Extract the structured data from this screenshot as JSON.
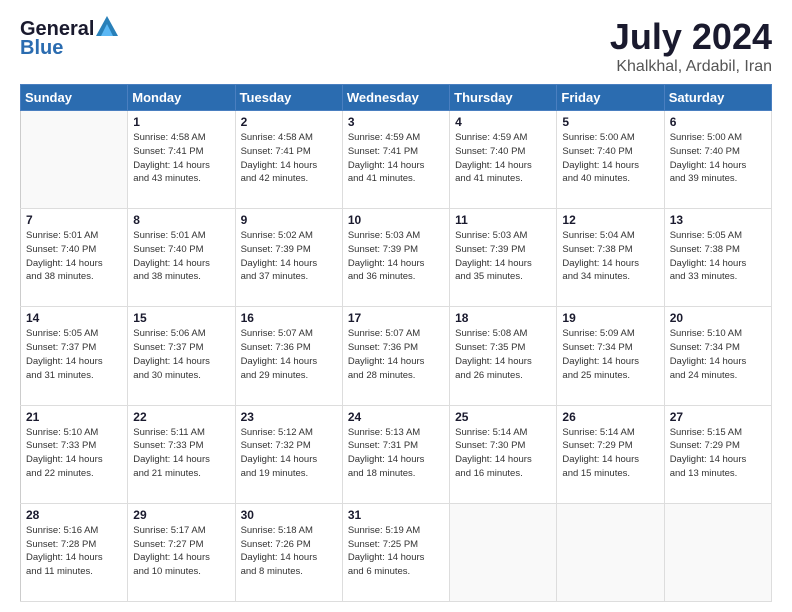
{
  "logo": {
    "line1": "General",
    "line2": "Blue"
  },
  "title": "July 2024",
  "subtitle": "Khalkhal, Ardabil, Iran",
  "weekdays": [
    "Sunday",
    "Monday",
    "Tuesday",
    "Wednesday",
    "Thursday",
    "Friday",
    "Saturday"
  ],
  "weeks": [
    [
      {
        "day": null,
        "sunrise": null,
        "sunset": null,
        "daylight": null
      },
      {
        "day": "1",
        "sunrise": "4:58 AM",
        "sunset": "7:41 PM",
        "daylight": "14 hours and 43 minutes."
      },
      {
        "day": "2",
        "sunrise": "4:58 AM",
        "sunset": "7:41 PM",
        "daylight": "14 hours and 42 minutes."
      },
      {
        "day": "3",
        "sunrise": "4:59 AM",
        "sunset": "7:41 PM",
        "daylight": "14 hours and 41 minutes."
      },
      {
        "day": "4",
        "sunrise": "4:59 AM",
        "sunset": "7:40 PM",
        "daylight": "14 hours and 41 minutes."
      },
      {
        "day": "5",
        "sunrise": "5:00 AM",
        "sunset": "7:40 PM",
        "daylight": "14 hours and 40 minutes."
      },
      {
        "day": "6",
        "sunrise": "5:00 AM",
        "sunset": "7:40 PM",
        "daylight": "14 hours and 39 minutes."
      }
    ],
    [
      {
        "day": "7",
        "sunrise": "5:01 AM",
        "sunset": "7:40 PM",
        "daylight": "14 hours and 38 minutes."
      },
      {
        "day": "8",
        "sunrise": "5:01 AM",
        "sunset": "7:40 PM",
        "daylight": "14 hours and 38 minutes."
      },
      {
        "day": "9",
        "sunrise": "5:02 AM",
        "sunset": "7:39 PM",
        "daylight": "14 hours and 37 minutes."
      },
      {
        "day": "10",
        "sunrise": "5:03 AM",
        "sunset": "7:39 PM",
        "daylight": "14 hours and 36 minutes."
      },
      {
        "day": "11",
        "sunrise": "5:03 AM",
        "sunset": "7:39 PM",
        "daylight": "14 hours and 35 minutes."
      },
      {
        "day": "12",
        "sunrise": "5:04 AM",
        "sunset": "7:38 PM",
        "daylight": "14 hours and 34 minutes."
      },
      {
        "day": "13",
        "sunrise": "5:05 AM",
        "sunset": "7:38 PM",
        "daylight": "14 hours and 33 minutes."
      }
    ],
    [
      {
        "day": "14",
        "sunrise": "5:05 AM",
        "sunset": "7:37 PM",
        "daylight": "14 hours and 31 minutes."
      },
      {
        "day": "15",
        "sunrise": "5:06 AM",
        "sunset": "7:37 PM",
        "daylight": "14 hours and 30 minutes."
      },
      {
        "day": "16",
        "sunrise": "5:07 AM",
        "sunset": "7:36 PM",
        "daylight": "14 hours and 29 minutes."
      },
      {
        "day": "17",
        "sunrise": "5:07 AM",
        "sunset": "7:36 PM",
        "daylight": "14 hours and 28 minutes."
      },
      {
        "day": "18",
        "sunrise": "5:08 AM",
        "sunset": "7:35 PM",
        "daylight": "14 hours and 26 minutes."
      },
      {
        "day": "19",
        "sunrise": "5:09 AM",
        "sunset": "7:34 PM",
        "daylight": "14 hours and 25 minutes."
      },
      {
        "day": "20",
        "sunrise": "5:10 AM",
        "sunset": "7:34 PM",
        "daylight": "14 hours and 24 minutes."
      }
    ],
    [
      {
        "day": "21",
        "sunrise": "5:10 AM",
        "sunset": "7:33 PM",
        "daylight": "14 hours and 22 minutes."
      },
      {
        "day": "22",
        "sunrise": "5:11 AM",
        "sunset": "7:33 PM",
        "daylight": "14 hours and 21 minutes."
      },
      {
        "day": "23",
        "sunrise": "5:12 AM",
        "sunset": "7:32 PM",
        "daylight": "14 hours and 19 minutes."
      },
      {
        "day": "24",
        "sunrise": "5:13 AM",
        "sunset": "7:31 PM",
        "daylight": "14 hours and 18 minutes."
      },
      {
        "day": "25",
        "sunrise": "5:14 AM",
        "sunset": "7:30 PM",
        "daylight": "14 hours and 16 minutes."
      },
      {
        "day": "26",
        "sunrise": "5:14 AM",
        "sunset": "7:29 PM",
        "daylight": "14 hours and 15 minutes."
      },
      {
        "day": "27",
        "sunrise": "5:15 AM",
        "sunset": "7:29 PM",
        "daylight": "14 hours and 13 minutes."
      }
    ],
    [
      {
        "day": "28",
        "sunrise": "5:16 AM",
        "sunset": "7:28 PM",
        "daylight": "14 hours and 11 minutes."
      },
      {
        "day": "29",
        "sunrise": "5:17 AM",
        "sunset": "7:27 PM",
        "daylight": "14 hours and 10 minutes."
      },
      {
        "day": "30",
        "sunrise": "5:18 AM",
        "sunset": "7:26 PM",
        "daylight": "14 hours and 8 minutes."
      },
      {
        "day": "31",
        "sunrise": "5:19 AM",
        "sunset": "7:25 PM",
        "daylight": "14 hours and 6 minutes."
      },
      {
        "day": null,
        "sunrise": null,
        "sunset": null,
        "daylight": null
      },
      {
        "day": null,
        "sunrise": null,
        "sunset": null,
        "daylight": null
      },
      {
        "day": null,
        "sunrise": null,
        "sunset": null,
        "daylight": null
      }
    ]
  ],
  "labels": {
    "sunrise": "Sunrise:",
    "sunset": "Sunset:",
    "daylight": "Daylight:"
  }
}
